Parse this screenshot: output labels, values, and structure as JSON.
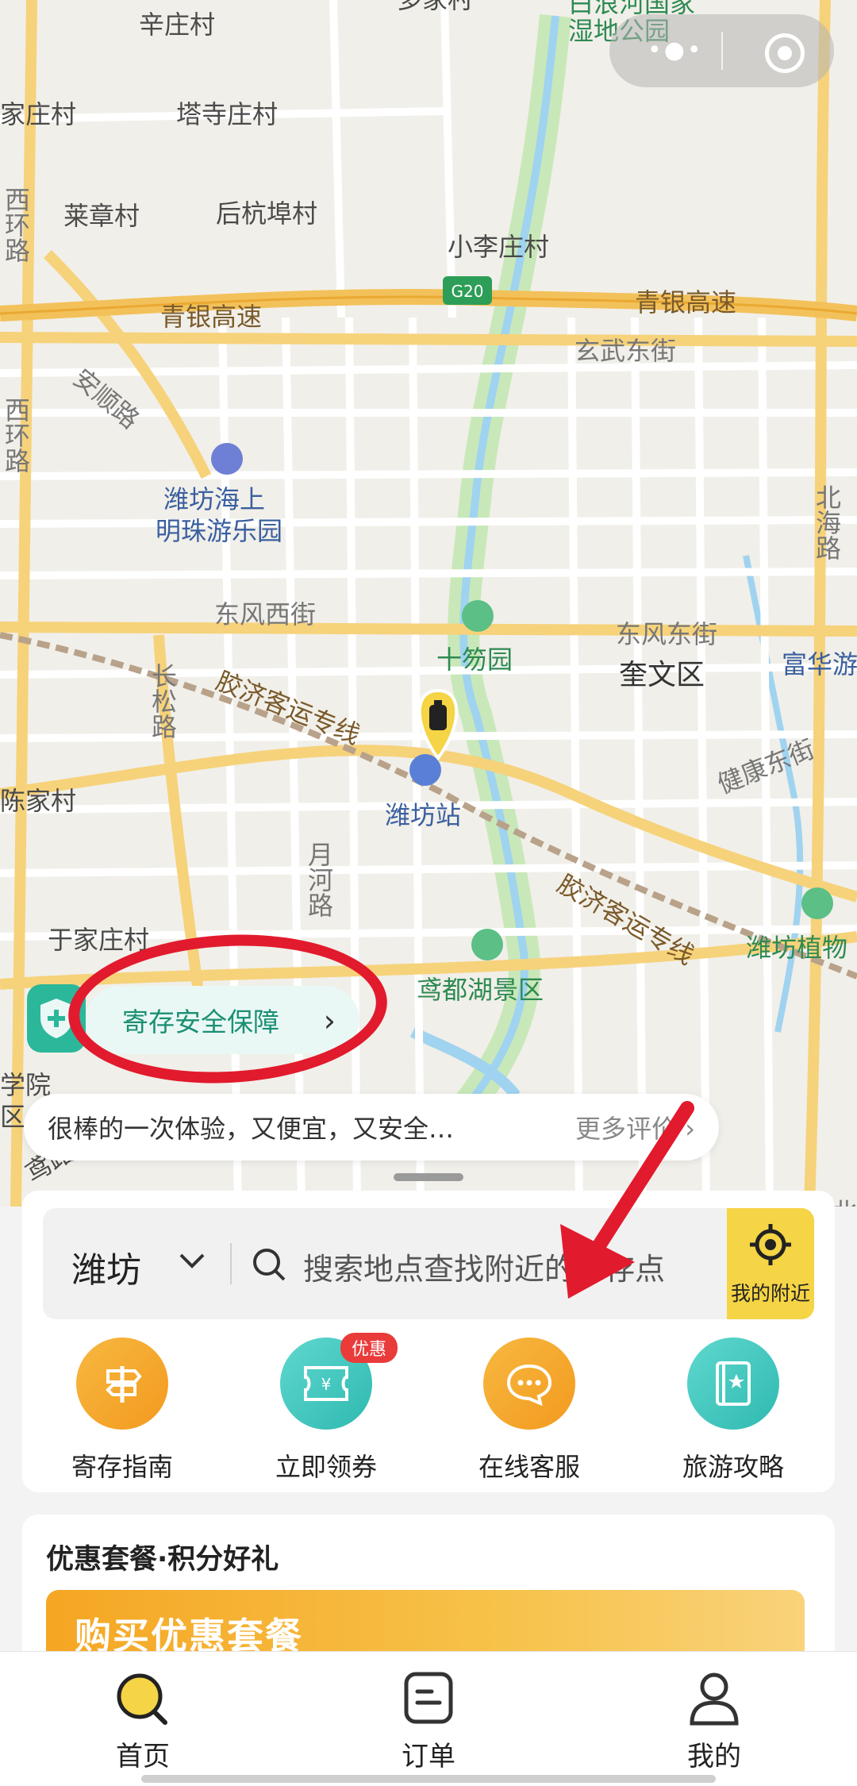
{
  "map": {
    "labels": [
      "辛庄村",
      "塔寺庄村",
      "家庄村",
      "莱章村",
      "后杭埠村",
      "小李庄村",
      "青银高速",
      "青银高速",
      "玄武东街",
      "安顺路",
      "西环路",
      "西环路",
      "潍坊海上",
      "明珠游乐园",
      "东风西街",
      "东风东街",
      "十笏园",
      "奎文区",
      "富华游",
      "长松路",
      "胶济客运专线",
      "潍坊站",
      "陈家村",
      "月河路",
      "健康东街",
      "胶济客运专线",
      "于家庄村",
      "潍坊植物",
      "鸢都湖景区",
      "北海路",
      "北海路",
      "学院",
      "区",
      "鸢路",
      "G20",
      "白浪河国家",
      "湿地公园",
      "多家村"
    ]
  },
  "capsule": {
    "more_icon": "more-dots-icon",
    "close_icon": "mini-program-close-icon"
  },
  "guarantee": {
    "label": "寄存安全保障",
    "chevron": "›"
  },
  "review": {
    "text": "很棒的一次体验，又便宜，又安全…",
    "more": "更多评价 ›"
  },
  "search": {
    "city": "潍坊",
    "placeholder": "搜索地点查找附近的寄存点",
    "nearby_label": "我的附近"
  },
  "quick_actions": [
    {
      "label": "寄存指南",
      "icon": "signpost-icon",
      "color": "#f5a623"
    },
    {
      "label": "立即领券",
      "icon": "coupon-icon",
      "color": "#3cc8c0",
      "badge": "优惠"
    },
    {
      "label": "在线客服",
      "icon": "chat-bubble-icon",
      "color": "#f5a623"
    },
    {
      "label": "旅游攻略",
      "icon": "guidebook-icon",
      "color": "#3cc8c0"
    }
  ],
  "promo": {
    "title": "优惠套餐·积分好礼",
    "banner_text": "购买优惠套餐"
  },
  "tabs": [
    {
      "label": "首页",
      "icon": "search-magnifier-icon"
    },
    {
      "label": "订单",
      "icon": "order-document-icon"
    },
    {
      "label": "我的",
      "icon": "user-profile-icon"
    }
  ],
  "colors": {
    "accent": "#f5d445",
    "highway": "#f3c15a",
    "annotation": "#e21a2d",
    "teal": "#2bb79a"
  }
}
